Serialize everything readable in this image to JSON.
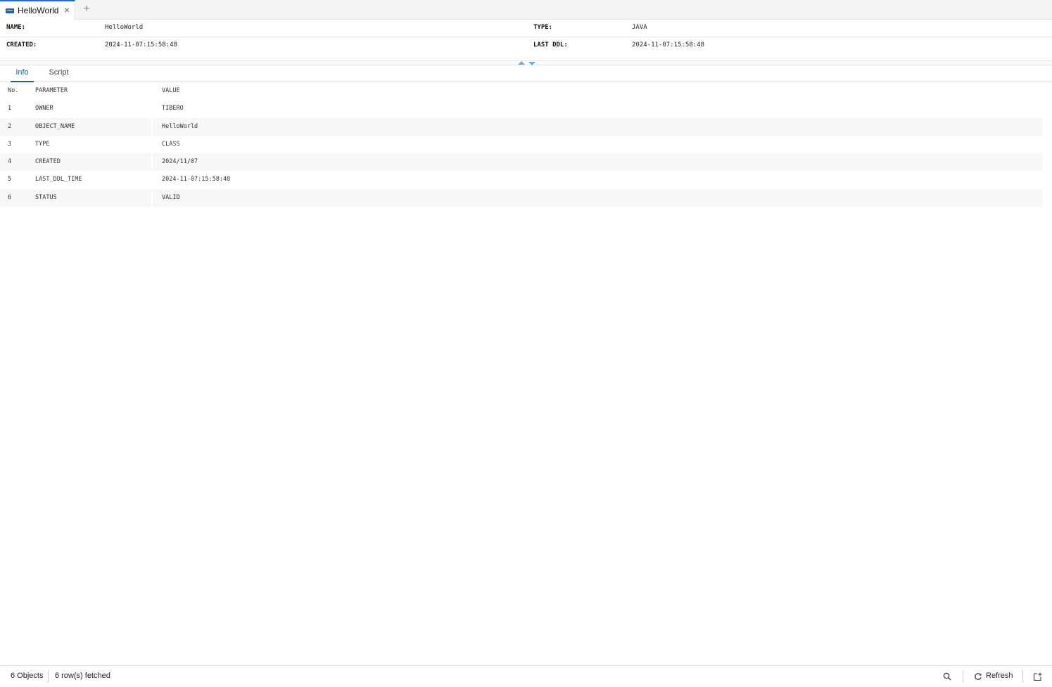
{
  "tabs": [
    {
      "label": "HelloWorld",
      "icon": "java-object-icon",
      "active": true
    }
  ],
  "add_tab_icon": "plus-icon",
  "properties": {
    "name_label": "NAME:",
    "name_value": "HelloWorld",
    "type_label": "TYPE:",
    "type_value": "JAVA",
    "created_label": "CREATED:",
    "created_value": "2024-11-07:15:58:48",
    "last_ddl_label": "LAST DDL:",
    "last_ddl_value": "2024-11-07:15:58:48"
  },
  "subtabs": [
    {
      "label": "Info",
      "active": true
    },
    {
      "label": "Script",
      "active": false
    }
  ],
  "grid": {
    "columns": [
      "No.",
      "PARAMETER",
      "VALUE"
    ],
    "rows": [
      {
        "no": "1",
        "param": "OWNER",
        "value": "TIBERO"
      },
      {
        "no": "2",
        "param": "OBJECT_NAME",
        "value": "HelloWorld"
      },
      {
        "no": "3",
        "param": "TYPE",
        "value": "CLASS"
      },
      {
        "no": "4",
        "param": "CREATED",
        "value": "2024/11/07"
      },
      {
        "no": "5",
        "param": "LAST_DDL_TIME",
        "value": "2024-11-07:15:58:48"
      },
      {
        "no": "6",
        "param": "STATUS",
        "value": "VALID"
      }
    ]
  },
  "statusbar": {
    "objects": "6 Objects",
    "fetched": "6 row(s) fetched",
    "refresh_label": "Refresh",
    "icons": [
      "search-icon",
      "refresh-icon",
      "export-icon"
    ]
  },
  "colors": {
    "accent": "#1a5fa8",
    "row_alt": "#f6f7f8",
    "tabstrip_bg": "#f3f4f6"
  }
}
